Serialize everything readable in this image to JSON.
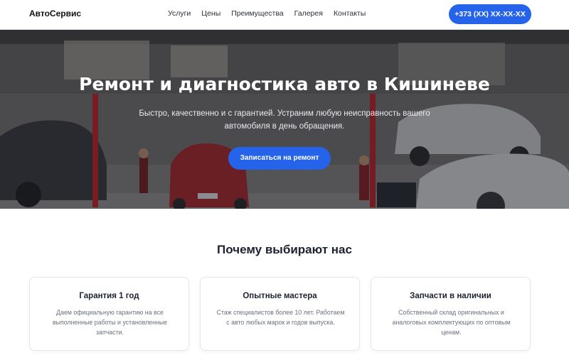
{
  "header": {
    "logo": "АвтоСервис",
    "nav": [
      "Услуги",
      "Цены",
      "Преимущества",
      "Галерея",
      "Контакты"
    ],
    "phone": "+373 (XX) XX-XX-XX"
  },
  "hero": {
    "title": "Ремонт и диагностика авто в Кишиневе",
    "subtitle": "Быстро, качественно и с гарантией. Устраним любую неисправность вашего автомобиля в день обращения.",
    "cta": "Записаться на ремонт"
  },
  "features": {
    "title": "Почему выбирают нас",
    "cards": [
      {
        "title": "Гарантия 1 год",
        "text": "Даем официальную гарантию на все выполненные работы и установленные запчасти."
      },
      {
        "title": "Опытные мастера",
        "text": "Стаж специалистов более 10 лет. Работаем с авто любых марок и годов выпуска."
      },
      {
        "title": "Запчасти в наличии",
        "text": "Собственный склад оригинальных и аналоговых комплектующих по оптовым ценам."
      }
    ]
  },
  "colors": {
    "accent": "#2563eb"
  }
}
